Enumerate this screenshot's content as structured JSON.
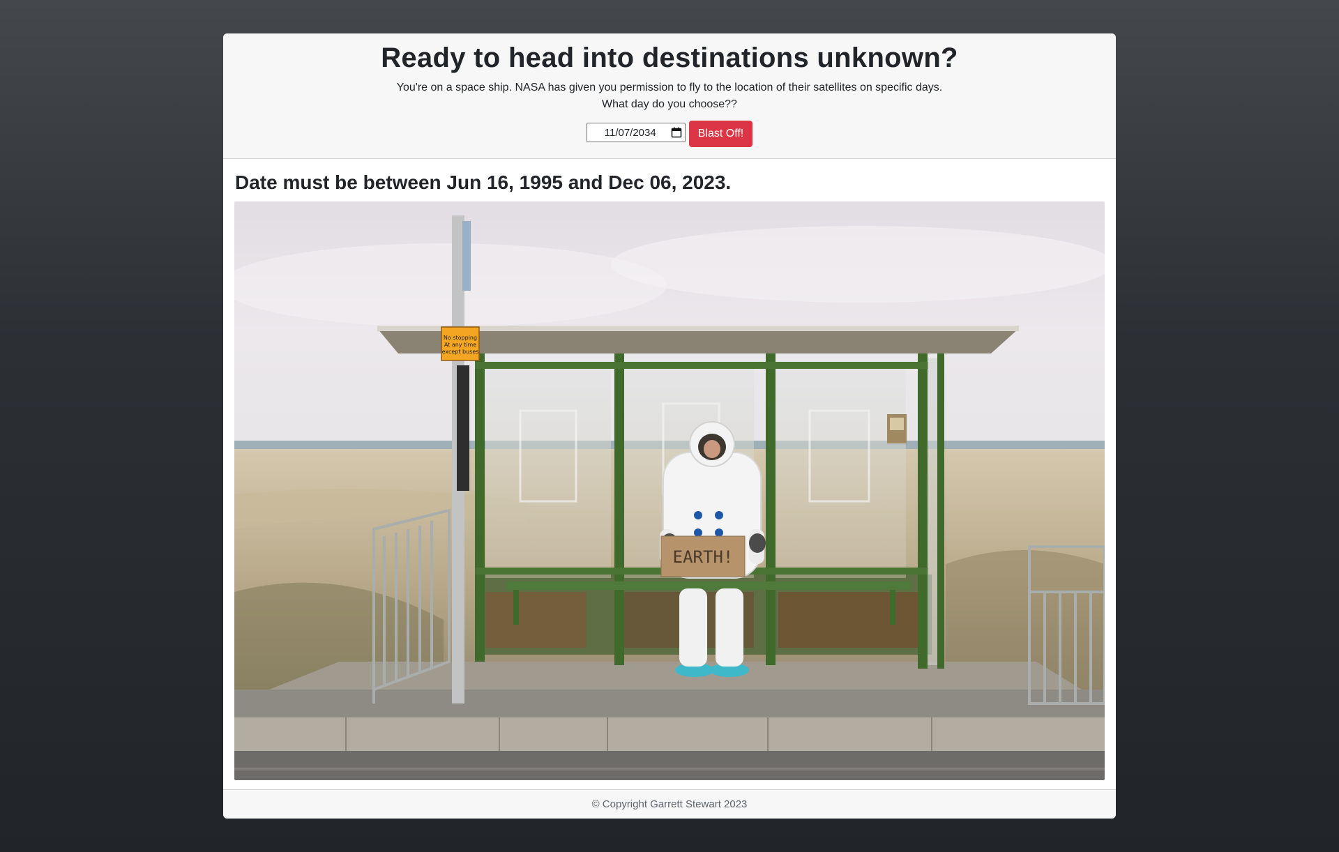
{
  "header": {
    "title": "Ready to head into destinations unknown?",
    "description_line1": "You're on a space ship. NASA has given you permission to fly to the location of their satellites on specific days.",
    "description_line2": "What day do you choose??"
  },
  "form": {
    "date_value": "11/07/2034",
    "calendar_icon": "calendar-icon",
    "submit_label": "Blast Off!",
    "submit_color": "#dc3545"
  },
  "result": {
    "error_message": "Date must be between Jun 16, 1995 and Dec 06, 2023."
  },
  "photo": {
    "sign_text_line1": "No stopping",
    "sign_text_line2": "At any time",
    "sign_text_line3": "except buses",
    "cardboard_text": "EARTH!"
  },
  "footer": {
    "copyright": "© Copyright Garrett Stewart 2023"
  }
}
